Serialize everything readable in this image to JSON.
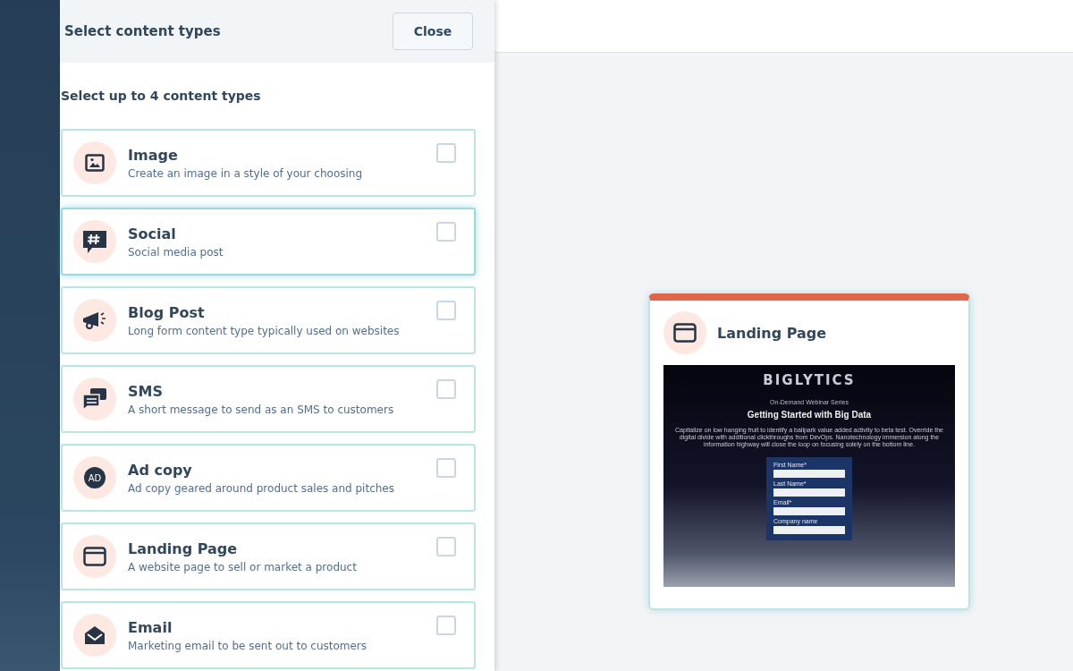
{
  "panel": {
    "title": "Select content types",
    "close_button": "Close",
    "instruction": "Select up to 4 content types"
  },
  "content_types": [
    {
      "kind": "image",
      "title": "Image",
      "description": "Create an image in a style of your choosing",
      "checked": false,
      "hovered": false
    },
    {
      "kind": "social",
      "title": "Social",
      "description": "Social media post",
      "checked": false,
      "hovered": true
    },
    {
      "kind": "blog",
      "title": "Blog Post",
      "description": "Long form content type typically used on websites",
      "checked": false,
      "hovered": false
    },
    {
      "kind": "sms",
      "title": "SMS",
      "description": "A short message to send as an SMS to customers",
      "checked": false,
      "hovered": false
    },
    {
      "kind": "ad",
      "title": "Ad copy",
      "description": "Ad copy geared around product sales and pitches",
      "checked": false,
      "hovered": false,
      "icon_label": "AD"
    },
    {
      "kind": "landing",
      "title": "Landing Page",
      "description": "A website page to sell or market a product",
      "checked": false,
      "hovered": false
    },
    {
      "kind": "email",
      "title": "Email",
      "description": "Marketing email to be sent out to customers",
      "checked": false,
      "hovered": false
    }
  ],
  "preview_card": {
    "title": "Landing Page",
    "page": {
      "logo": "BIGLYTICS",
      "eyebrow": "On-Demand Webinar Series",
      "heading": "Getting Started with Big Data",
      "body": "Capitalize on low hanging fruit to identify a ballpark value added activity to beta test. Override the digital divide with additional clickthroughs from DevOps. Nanotechnology immersion along the information highway will close the loop on focusing solely on the bottom line.",
      "form_fields": [
        "First Name*",
        "Last Name*",
        "Email*",
        "Company name"
      ]
    }
  }
}
